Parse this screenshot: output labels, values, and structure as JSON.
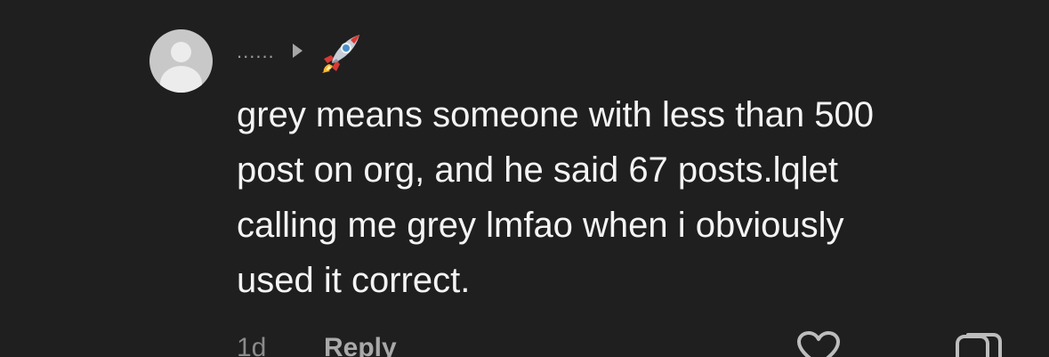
{
  "comment": {
    "username": "......",
    "flair_icon": "rocket-icon",
    "text": "grey means someone with less than 500\npost on org, and he said 67 posts.lqlet\ncalling me grey lmfao when i obviously\nused it correct.",
    "timestamp": "1d",
    "reply_label": "Reply",
    "like_icon": "heart-icon",
    "share_icon": "chat-bubbles-icon"
  },
  "colors": {
    "background": "#1f1f1f",
    "text": "#f4f4f4",
    "muted": "#8b8b8b",
    "avatar": "#c8c8c8"
  }
}
